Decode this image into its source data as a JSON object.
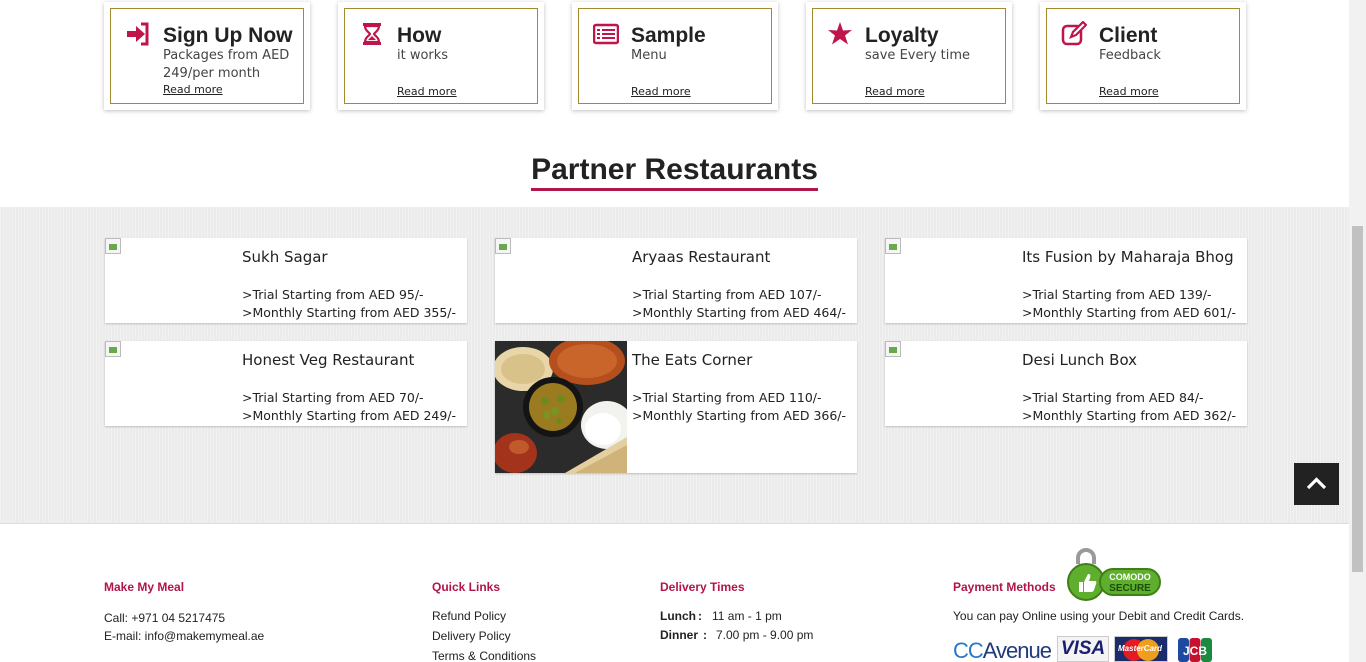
{
  "features": [
    {
      "title": "Sign Up Now",
      "subtitle": "Packages from AED 249/per month",
      "link": "Read more",
      "icon": "sign-in-icon"
    },
    {
      "title": "How",
      "subtitle": "it works",
      "link": "Read more",
      "icon": "hourglass-icon"
    },
    {
      "title": "Sample",
      "subtitle": "Menu",
      "link": "Read more",
      "icon": "menu-list-icon"
    },
    {
      "title": "Loyalty",
      "subtitle": "save Every time",
      "link": "Read more",
      "icon": "star-icon"
    },
    {
      "title": "Client",
      "subtitle": "Feedback",
      "link": "Read more",
      "icon": "edit-icon"
    }
  ],
  "partners": {
    "title": "Partner Restaurants",
    "restaurants": [
      {
        "name": "Sukh Sagar",
        "trial": ">Trial Starting from AED 95/-",
        "monthly": ">Monthly Starting from AED 355/-"
      },
      {
        "name": "Aryaas Restaurant",
        "trial": ">Trial Starting from AED 107/-",
        "monthly": ">Monthly Starting from AED 464/-"
      },
      {
        "name": "Its Fusion by Maharaja Bhog",
        "trial": ">Trial Starting from AED 139/-",
        "monthly": ">Monthly Starting from AED 601/-"
      },
      {
        "name": "Honest Veg Restaurant",
        "trial": ">Trial Starting from AED 70/-",
        "monthly": ">Monthly Starting from AED 249/-"
      },
      {
        "name": "The Eats Corner",
        "trial": ">Trial Starting from AED 110/-",
        "monthly": ">Monthly Starting from AED 366/-"
      },
      {
        "name": "Desi Lunch Box",
        "trial": ">Trial Starting from AED 84/-",
        "monthly": ">Monthly Starting from AED 362/-"
      }
    ]
  },
  "footer": {
    "company": {
      "heading": "Make My Meal",
      "call": "Call: +971 04 5217475",
      "email": "E-mail: info@makemymeal.ae"
    },
    "quick_links": {
      "heading": "Quick Links",
      "links": [
        "Refund Policy",
        "Delivery Policy",
        "Terms & Conditions"
      ]
    },
    "delivery": {
      "heading": "Delivery Times",
      "lunch_label": "Lunch",
      "lunch_time": "11 am - 1 pm",
      "dinner_label": "Dinner",
      "dinner_time": "7.00 pm - 9.00 pm",
      "separator": ":"
    },
    "payment": {
      "heading": "Payment Methods",
      "text": "You can pay Online using your Debit and Credit Cards.",
      "badge_top": "COMODO",
      "badge_bottom": "SECURE",
      "logos": [
        "CC Avenue",
        "VISA",
        "MasterCard",
        "JCB"
      ]
    }
  },
  "colors": {
    "accent": "#b0154b",
    "feature_border": "#a48a2f",
    "band_bg": "#ebebeb"
  }
}
